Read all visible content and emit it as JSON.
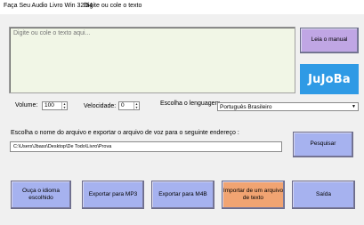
{
  "window": {
    "title": "Faça Seu Audio Livro Win 32/64",
    "subtitle": "Digite ou cole o texto"
  },
  "text_area": {
    "placeholder": "Digite ou cole o texto aqui..."
  },
  "buttons": {
    "manual": "Leia o manual",
    "search": "Pesquisar",
    "listen": "Ouça o idioma escolhido",
    "export_mp3": "Exportar para MP3",
    "export_m4b": "Exportar para M4B",
    "import_text": "Importar de um arquivo de texto",
    "exit": "Saída"
  },
  "logo": {
    "text": "JuJoBa",
    "color": "#2f9ae5"
  },
  "controls": {
    "volume_label": "Volume:",
    "volume_value": "100",
    "speed_label": "Velocidade:",
    "speed_value": "0",
    "language_label": "Escolha o lenguagem",
    "language_value": "Português Brasileiro"
  },
  "export": {
    "label": "Escolha o nome do arquivo e exportar o arquivo de voz para o seguinte endereço :",
    "path": "C:\\Users\\Jbass\\Desktop\\De Todo\\Livro\\Prova"
  },
  "colors": {
    "button_blue": "#a6b2ef",
    "button_purple": "#c0a6e4",
    "button_orange": "#f1a472",
    "text_area_bg": "#f1f6e6"
  }
}
